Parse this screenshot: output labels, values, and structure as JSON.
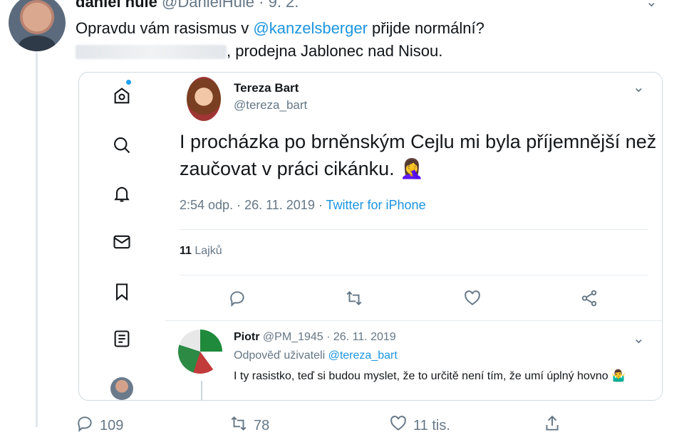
{
  "tweet": {
    "author_name": "daniel hule",
    "author_handle": "@DanielHule",
    "separator": "·",
    "date": "9. 2.",
    "text_line1_pre": "Opravdu vám rasismus v ",
    "text_line1_mention": "@kanzelsberger",
    "text_line1_post": " přijde normální?",
    "text_line2_post": ", prodejna Jablonec nad Nisou."
  },
  "embed": {
    "author_name": "Tereza Bart",
    "author_handle": "@tereza_bart",
    "text": "I procházka po brněnským Cejlu mi byla příjemnější než zaučovat v práci cikánku. 🤦‍♀️",
    "time": "2:54 odp.",
    "date": "26. 11. 2019",
    "source": "Twitter for iPhone",
    "likes_count": "11",
    "likes_label": "Lajků",
    "reply": {
      "author_name": "Piotr",
      "author_handle": "@PM_1945",
      "date": "26. 11. 2019",
      "replying_to_label": "Odpověď uživateli",
      "replying_to_handle": "@tereza_bart",
      "text": "I ty rasistko, teď si budou myslet, že to určitě není tím, že umí úplný hovno 🤷‍♂️"
    }
  },
  "bottom_actions": {
    "reply_count": "109",
    "retweet_count": "78",
    "like_count": "11 tis."
  },
  "icons": [
    "home-icon",
    "search-icon",
    "notifications-icon",
    "messages-icon",
    "bookmarks-icon",
    "lists-icon",
    "reply-icon",
    "retweet-icon",
    "like-icon",
    "share-icon",
    "chevron-down-icon"
  ],
  "colors": {
    "accent": "#1b95e0",
    "muted": "#657786",
    "border": "#cfd9de"
  }
}
